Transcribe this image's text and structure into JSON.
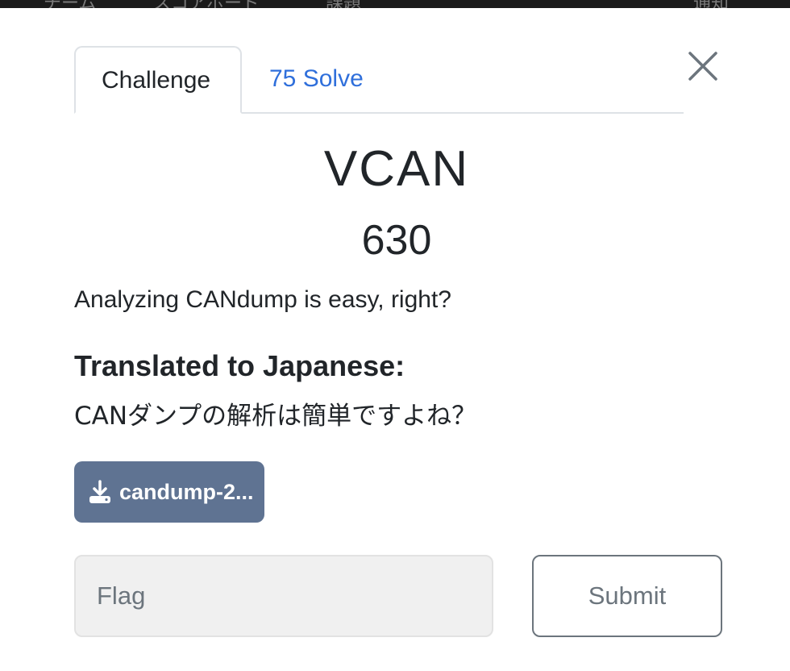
{
  "backdrop": {
    "nav_items": [
      "チーム",
      "スコアボード",
      "課題",
      "通知"
    ]
  },
  "modal": {
    "tabs": [
      {
        "label": "Challenge",
        "active": true
      },
      {
        "label": "75 Solve",
        "active": false
      }
    ],
    "close_icon": "close-icon",
    "title": "VCAN",
    "points": "630",
    "description": "Analyzing CANdump is easy, right?",
    "subheading": "Translated to Japanese:",
    "japanese_text": "CANダンプの解析は簡単ですよね？",
    "download": {
      "label": "candump-2...",
      "icon": "download-icon"
    },
    "flag_input": {
      "placeholder": "Flag",
      "value": ""
    },
    "submit_label": "Submit"
  },
  "colors": {
    "tab_link": "#2f6fdb",
    "download_button": "#5f7392",
    "input_background": "#f0f0f0",
    "submit_border": "#6c757d"
  }
}
